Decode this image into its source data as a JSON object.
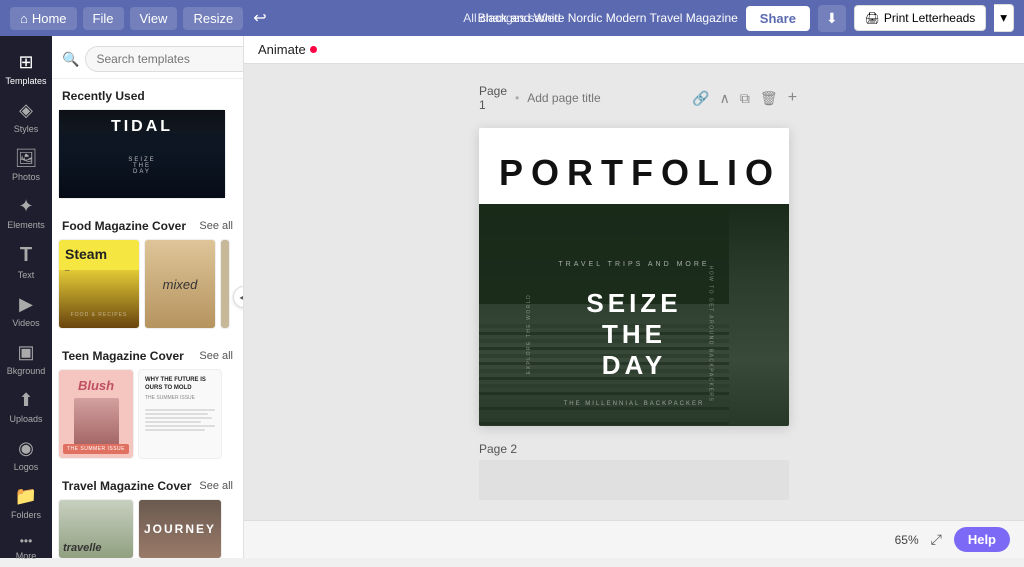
{
  "topbar": {
    "home_label": "Home",
    "file_label": "File",
    "view_label": "View",
    "resize_label": "Resize",
    "saved_status": "All changes saved",
    "doc_title": "Black and White Nordic Modern Travel Magazine",
    "share_label": "Share",
    "print_label": "Print Letterheads"
  },
  "sidebar": {
    "items": [
      {
        "id": "templates",
        "label": "Templates",
        "icon": "⊞",
        "active": true
      },
      {
        "id": "styles",
        "label": "Styles",
        "icon": "◈"
      },
      {
        "id": "photos",
        "label": "Photos",
        "icon": "🖼"
      },
      {
        "id": "elements",
        "label": "Elements",
        "icon": "✦"
      },
      {
        "id": "text",
        "label": "Text",
        "icon": "T"
      },
      {
        "id": "videos",
        "label": "Videos",
        "icon": "▶"
      },
      {
        "id": "background",
        "label": "Bkground",
        "icon": "▣"
      },
      {
        "id": "uploads",
        "label": "Uploads",
        "icon": "⬆"
      },
      {
        "id": "logos",
        "label": "Logos",
        "icon": "◉"
      },
      {
        "id": "folders",
        "label": "Folders",
        "icon": "📁"
      },
      {
        "id": "more",
        "label": "More",
        "icon": "···"
      }
    ]
  },
  "templates_panel": {
    "search_placeholder": "Search templates",
    "recently_used_title": "Recently Used",
    "recently_used_name": "TIDAL",
    "recently_used_sub": "SEIZE THE DAY",
    "food_section_title": "Food Magazine Cover",
    "food_see_all": "See all",
    "food_thumbs": [
      {
        "id": "steam",
        "label": "Steam",
        "sub_label": "_"
      },
      {
        "id": "mixed",
        "label": "mixed"
      },
      {
        "id": "third",
        "label": ""
      }
    ],
    "teen_section_title": "Teen Magazine Cover",
    "teen_see_all": "See all",
    "teen_thumbs": [
      {
        "id": "blush",
        "label": "Blush"
      },
      {
        "id": "why-future",
        "label": "WHY THE FUTURE IS OURS TO MOLD",
        "sub": "THE SUMMER ISSUE"
      }
    ],
    "travel_section_title": "Travel Magazine Cover",
    "travel_see_all": "See all",
    "travel_thumbs": [
      {
        "id": "travelle",
        "label": "travelle"
      },
      {
        "id": "journey",
        "label": "JOURNEY"
      }
    ]
  },
  "canvas": {
    "animate_label": "Animate",
    "page1_label": "Page 1",
    "page1_title_placeholder": "Add page title",
    "page2_label": "Page 2",
    "zoom_level": "65%",
    "help_label": "Help",
    "magazine": {
      "title": "PORTFOLIO",
      "travel_trips": "TRAVEL TRIPS AND MORE",
      "seize_line1": "SEIZE",
      "seize_line2": "THE",
      "seize_line3": "DAY",
      "side_left": "EXPLORE THE WORLD",
      "side_right": "HOW TO GET AROUND BACKPACKERS",
      "millennial": "THE MILLENNIAL BACKPACKER"
    }
  }
}
